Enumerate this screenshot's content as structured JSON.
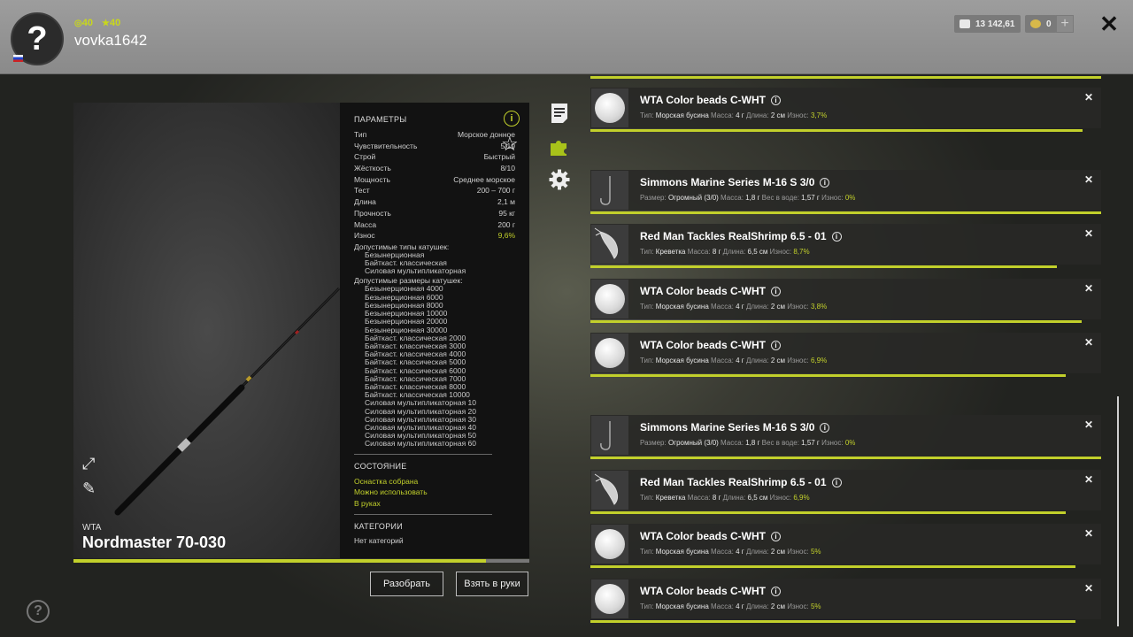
{
  "header": {
    "avatar_glyph": "?",
    "stat_circle": "40",
    "stat_star": "40",
    "username": "vovka1642",
    "silver": "13 142,61",
    "gold": "0",
    "plus": "+",
    "close": "✕"
  },
  "rod": {
    "brand": "WTA",
    "name": "Nordmaster 70-030",
    "wear_fraction": 0.904
  },
  "params": {
    "heading": "ПАРАМЕТРЫ",
    "rows": [
      {
        "label": "Тип",
        "value": "Морское донное"
      },
      {
        "label": "Чувствительность",
        "value": "5/10"
      },
      {
        "label": "Строй",
        "value": "Быстрый"
      },
      {
        "label": "Жёсткость",
        "value": "8/10"
      },
      {
        "label": "Мощность",
        "value": "Среднее морское"
      },
      {
        "label": "Тест",
        "value": "200 – 700 г"
      },
      {
        "label": "Длина",
        "value": "2,1 м"
      },
      {
        "label": "Прочность",
        "value": "95 кг"
      },
      {
        "label": "Масса",
        "value": "200 г"
      },
      {
        "label": "Износ",
        "value": "9,6%"
      }
    ],
    "reel_types_heading": "Допустимые типы катушек:",
    "reel_types": [
      "Безынерционная",
      "Байткаст. классическая",
      "Силовая мультипликаторная"
    ],
    "reel_sizes_heading": "Допустимые размеры катушек:",
    "reel_sizes": [
      "Безынерционная 4000",
      "Безынерционная 6000",
      "Безынерционная 8000",
      "Безынерционная 10000",
      "Безынерционная 20000",
      "Безынерционная 30000",
      "Байткаст. классическая 2000",
      "Байткаст. классическая 3000",
      "Байткаст. классическая 4000",
      "Байткаст. классическая 5000",
      "Байткаст. классическая 6000",
      "Байткаст. классическая 7000",
      "Байткаст. классическая 8000",
      "Байткаст. классическая 10000",
      "Силовая мультипликаторная 10",
      "Силовая мультипликаторная 20",
      "Силовая мультипликаторная 30",
      "Силовая мультипликаторная 40",
      "Силовая мультипликаторная 50",
      "Силовая мультипликаторная 60"
    ],
    "state_heading": "СОСТОЯНИЕ",
    "states": [
      "Оснастка собрана",
      "Можно использовать",
      "В руках"
    ],
    "categories_heading": "КАТЕГОРИИ",
    "categories_value": "Нет категорий",
    "info_glyph": "i",
    "star_glyph": "☆"
  },
  "buttons": {
    "disassemble": "Разобрать",
    "take": "Взять в руки"
  },
  "items": [
    {
      "title": "WTA Color beads C-WHT",
      "kind": "bead",
      "meta": [
        [
          "Тип:",
          "Морская бусина"
        ],
        [
          "Масса:",
          "4 г"
        ],
        [
          "Длина:",
          "2 см"
        ]
      ],
      "wear_label": "Износ:",
      "wear": "3,7%",
      "bar": 0.963
    },
    {
      "title": "Simmons Marine Series M-16 S 3/0",
      "kind": "hook",
      "meta": [
        [
          "Размер:",
          "Огромный (3/0)"
        ],
        [
          "Масса:",
          "1,8 г"
        ],
        [
          "Вес в воде:",
          "1,57 г"
        ]
      ],
      "wear_label": "Износ:",
      "wear": "0%",
      "bar": 1.0
    },
    {
      "title": "Red Man Tackles RealShrimp 6.5 - 01",
      "kind": "shrimp",
      "meta": [
        [
          "Тип:",
          "Креветка"
        ],
        [
          "Масса:",
          "8 г"
        ],
        [
          "Длина:",
          "6,5 см"
        ]
      ],
      "wear_label": "Износ:",
      "wear": "8,7%",
      "bar": 0.913
    },
    {
      "title": "WTA Color beads C-WHT",
      "kind": "bead",
      "meta": [
        [
          "Тип:",
          "Морская бусина"
        ],
        [
          "Масса:",
          "4 г"
        ],
        [
          "Длина:",
          "2 см"
        ]
      ],
      "wear_label": "Износ:",
      "wear": "3,8%",
      "bar": 0.962
    },
    {
      "title": "WTA Color beads C-WHT",
      "kind": "bead",
      "meta": [
        [
          "Тип:",
          "Морская бусина"
        ],
        [
          "Масса:",
          "4 г"
        ],
        [
          "Длина:",
          "2 см"
        ]
      ],
      "wear_label": "Износ:",
      "wear": "6,9%",
      "bar": 0.931
    },
    {
      "title": "Simmons Marine Series M-16 S 3/0",
      "kind": "hook",
      "meta": [
        [
          "Размер:",
          "Огромный (3/0)"
        ],
        [
          "Масса:",
          "1,8 г"
        ],
        [
          "Вес в воде:",
          "1,57 г"
        ]
      ],
      "wear_label": "Износ:",
      "wear": "0%",
      "bar": 1.0
    },
    {
      "title": "Red Man Tackles RealShrimp 6.5 - 01",
      "kind": "shrimp",
      "meta": [
        [
          "Тип:",
          "Креветка"
        ],
        [
          "Масса:",
          "8 г"
        ],
        [
          "Длина:",
          "6,5 см"
        ]
      ],
      "wear_label": "Износ:",
      "wear": "6,9%",
      "bar": 0.931
    },
    {
      "title": "WTA Color beads C-WHT",
      "kind": "bead",
      "meta": [
        [
          "Тип:",
          "Морская бусина"
        ],
        [
          "Масса:",
          "4 г"
        ],
        [
          "Длина:",
          "2 см"
        ]
      ],
      "wear_label": "Износ:",
      "wear": "5%",
      "bar": 0.95
    },
    {
      "title": "WTA Color beads C-WHT",
      "kind": "bead",
      "meta": [
        [
          "Тип:",
          "Морская бусина"
        ],
        [
          "Масса:",
          "4 г"
        ],
        [
          "Длина:",
          "2 см"
        ]
      ],
      "wear_label": "Износ:",
      "wear": "5%",
      "bar": 0.95
    }
  ],
  "help_glyph": "?",
  "colors": {
    "accent": "#c2d02b",
    "panel": "#121212",
    "header": "#959595"
  }
}
